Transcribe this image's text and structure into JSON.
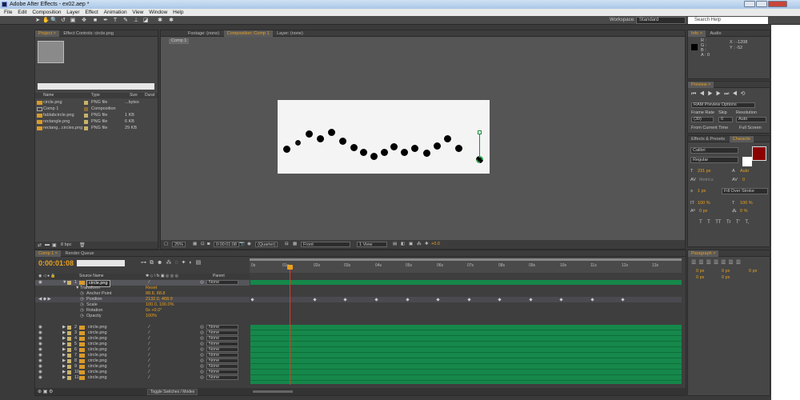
{
  "window": {
    "title": "Adobe After Effects - ex02.aep *"
  },
  "menu": [
    "File",
    "Edit",
    "Composition",
    "Layer",
    "Effect",
    "Animation",
    "View",
    "Window",
    "Help"
  ],
  "toolbar": {
    "workspace_label": "Workspace:",
    "workspace_value": "Standard",
    "search_placeholder": "Search Help"
  },
  "project": {
    "tabs": [
      "Project ×",
      "Effect Controls: circle.png"
    ],
    "columns": [
      "Name",
      "Type",
      "Size",
      "Durat"
    ],
    "items": [
      {
        "name": "circle.png",
        "type": "PNG file",
        "size": "...bytes",
        "color": "#e0b000"
      },
      {
        "name": "Comp 1",
        "type": "Composition",
        "size": "",
        "color": "#c0a060"
      },
      {
        "name": "fablabcircle.png",
        "type": "PNG file",
        "size": "1 KB",
        "color": "#e0b000"
      },
      {
        "name": "rectangle.png",
        "type": "PNG file",
        "size": "6 KB",
        "color": "#e0b000"
      },
      {
        "name": "rectang...circles.png",
        "type": "PNG file",
        "size": "29 KB",
        "color": "#e0b000"
      }
    ],
    "bpc": "8 bpc"
  },
  "viewer": {
    "tabs": [
      "Footage: (none)",
      "Composition: Comp 1",
      "Layer: (none)"
    ],
    "comp_button": "Comp 1",
    "zoom": "25%",
    "timecode": "0:00:01:08",
    "resolution": "(Quarter)",
    "view": "Front",
    "views": "1 View",
    "exposure": "+0.0"
  },
  "info": {
    "tabs": [
      "Info ×",
      "Audio"
    ],
    "rgba": [
      "R :",
      "G :",
      "B :",
      "A : 0"
    ],
    "x": "X : -1208",
    "y": "Y : -52"
  },
  "preview": {
    "title": "Preview ×",
    "ram": "RAM Preview Options",
    "frame_rate": "Frame Rate",
    "skip": "Skip",
    "resolution": "Resolution",
    "fps": "(30)",
    "skip_val": "0",
    "res_val": "Auto",
    "from_current": "From Current Time",
    "full_screen": "Full Screen"
  },
  "character": {
    "tabs": [
      "Effects & Presets",
      "Characte"
    ],
    "font": "Calibri",
    "style": "Regular",
    "size": "231 px",
    "leading": "Auto",
    "kerning": "Metrics",
    "tracking": "0",
    "stroke": "1 px",
    "stroke_mode": "Fill Over Stroke",
    "vscale": "100 %",
    "hscale": "100 %",
    "baseline": "0 px",
    "tsume": "0 %",
    "styles": "T T TT Tr T' T,"
  },
  "paragraph": {
    "title": "Paragraph ×",
    "indent": [
      "0 px",
      "0 px",
      "0 px"
    ],
    "space": [
      "0 px",
      "0 px"
    ]
  },
  "timeline": {
    "tabs": [
      "Comp 1 ×",
      "Render Queue"
    ],
    "timecode": "0:00:01:08",
    "columns": {
      "source": "Source Name",
      "parent": "Parent"
    },
    "ruler": [
      "0s",
      "01s",
      "02s",
      "03s",
      "04s",
      "05s",
      "06s",
      "07s",
      "08s",
      "09s",
      "10s",
      "11s",
      "12s",
      "13s"
    ],
    "layer1": {
      "num": "1",
      "name": "circle.png",
      "parent": "None"
    },
    "transform": "Transform",
    "reset": "Reset",
    "props": [
      {
        "name": "Anchor Point",
        "value": "88.8, 88.8"
      },
      {
        "name": "Position",
        "value": "2132.0, 468.9"
      },
      {
        "name": "Scale",
        "value": "100.0, 100.0%"
      },
      {
        "name": "Rotation",
        "value": "0x +0.0°"
      },
      {
        "name": "Opacity",
        "value": "100%"
      }
    ],
    "layers": [
      {
        "num": "2",
        "name": "circle.png",
        "parent": "None"
      },
      {
        "num": "3",
        "name": "circle.png",
        "parent": "None"
      },
      {
        "num": "4",
        "name": "circle.png",
        "parent": "None"
      },
      {
        "num": "5",
        "name": "circle.png",
        "parent": "None"
      },
      {
        "num": "6",
        "name": "circle.png",
        "parent": "None"
      },
      {
        "num": "7",
        "name": "circle.png",
        "parent": "None"
      },
      {
        "num": "8",
        "name": "circle.png",
        "parent": "None"
      },
      {
        "num": "9",
        "name": "circle.png",
        "parent": "None"
      },
      {
        "num": "10",
        "name": "circle.png",
        "parent": "None"
      },
      {
        "num": "11",
        "name": "circle.png",
        "parent": "None"
      }
    ],
    "toggle": "Toggle Switches / Modes"
  }
}
